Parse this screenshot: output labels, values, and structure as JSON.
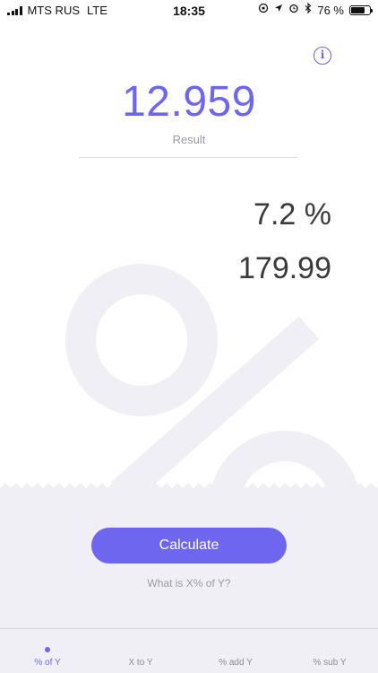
{
  "status_bar": {
    "carrier": "MTS RUS",
    "network": "LTE",
    "time": "18:35",
    "battery_percent": "76 %",
    "battery_level": 0.76,
    "icons": [
      "signal-icon",
      "orientation-lock-icon",
      "location-icon",
      "alarm-icon",
      "bluetooth-icon",
      "battery-icon"
    ]
  },
  "info_button": {
    "icon": "info-icon",
    "glyph": "i"
  },
  "result": {
    "value": "12.959",
    "label": "Result"
  },
  "inputs": {
    "x_value": "7.2 %",
    "y_value": "179.99"
  },
  "actions": {
    "calculate_label": "Calculate",
    "hint": "What is X% of Y?"
  },
  "tabs": [
    {
      "label": "% of Y",
      "active": true
    },
    {
      "label": "X to Y",
      "active": false
    },
    {
      "label": "% add Y",
      "active": false
    },
    {
      "label": "% sub Y",
      "active": false
    }
  ],
  "colors": {
    "accent": "#6f66f0",
    "panel_background": "#f0eff5",
    "text_muted": "#9a9aa2"
  }
}
